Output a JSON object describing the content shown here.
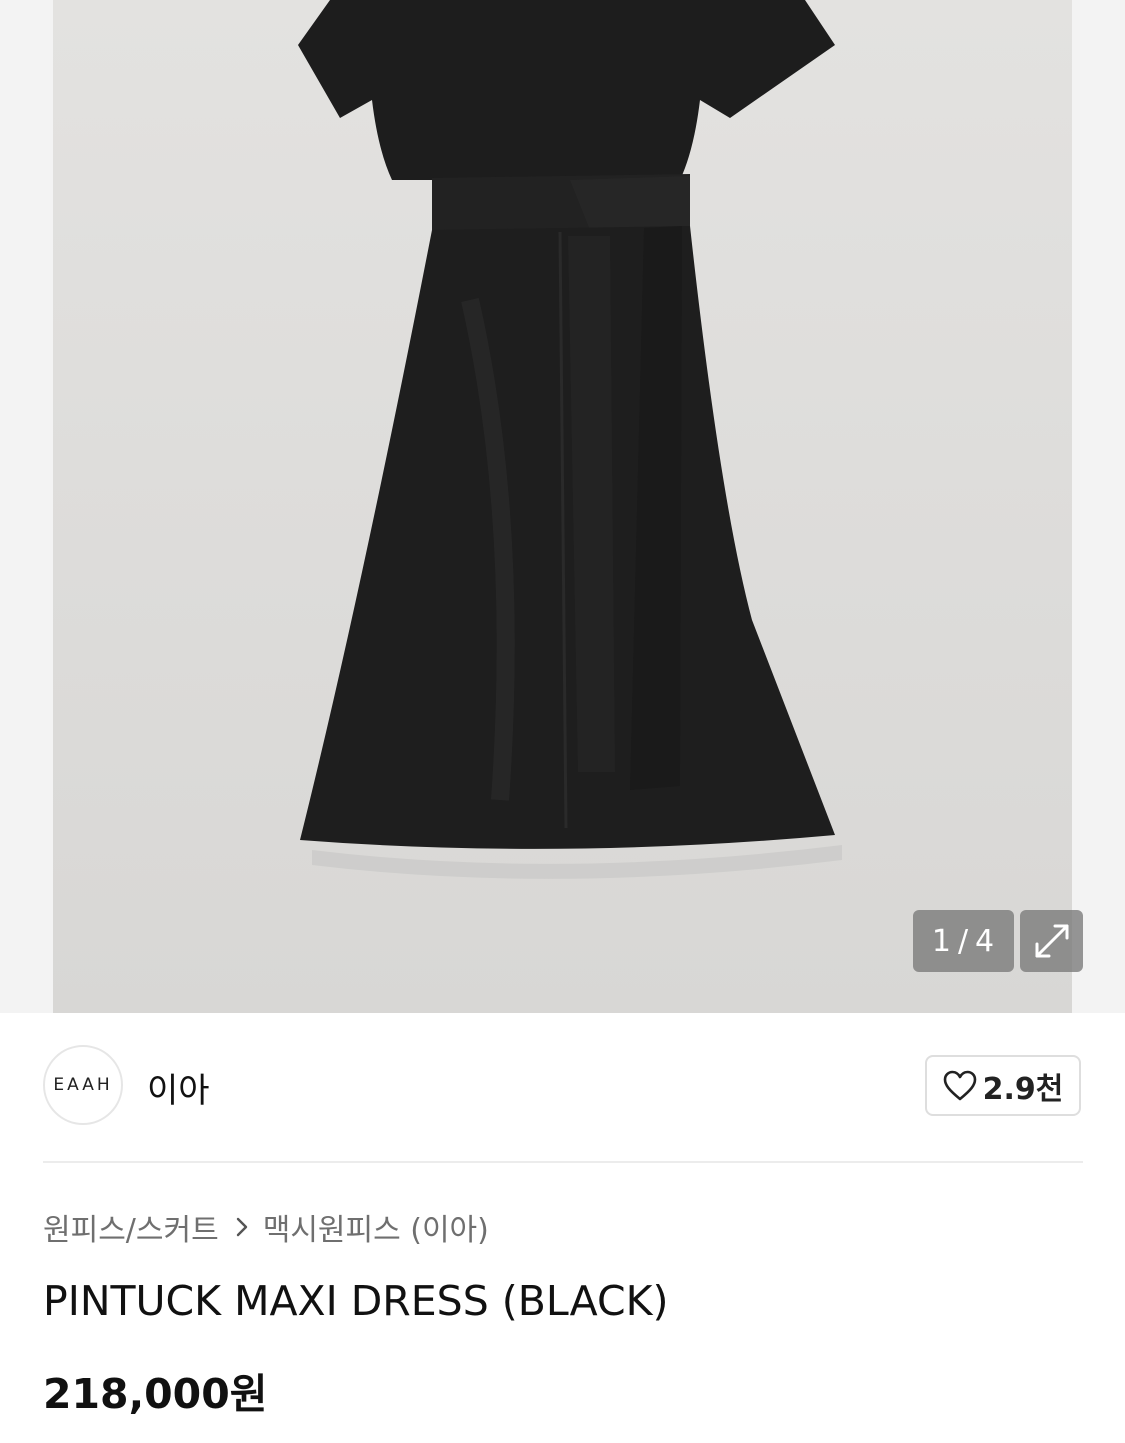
{
  "gallery": {
    "image_alt": "PINTUCK MAXI DRESS (BLACK) product photo",
    "current_index": "1",
    "separator": "/",
    "total": "4",
    "expand_icon": "expand-icon"
  },
  "brand": {
    "logo_text": "EAAH",
    "name": "이아"
  },
  "like": {
    "icon": "heart-icon",
    "count": "2.9천"
  },
  "breadcrumb": {
    "category": "원피스/스커트",
    "separator_icon": "chevron-right-icon",
    "subcategory": "맥시원피스 (이아)"
  },
  "product": {
    "title": "PINTUCK MAXI DRESS (BLACK)",
    "price": "218,000원"
  },
  "colors": {
    "page_background": "#ffffff",
    "photo_background": "#e0dfdd",
    "dress": "#1c1c1c",
    "overlay": "#787878",
    "divider": "#ececec",
    "breadcrumb_text": "#6f6f6f"
  }
}
